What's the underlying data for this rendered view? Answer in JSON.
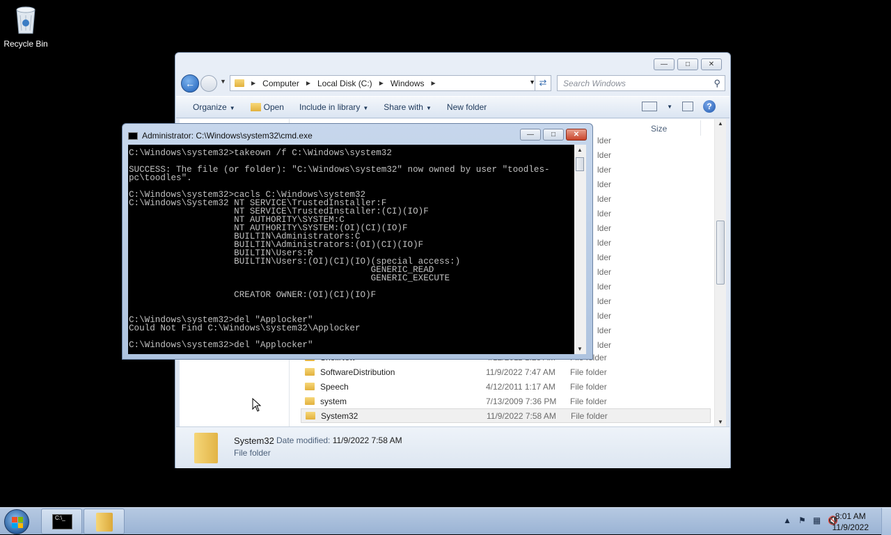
{
  "desktop": {
    "recycle_bin_label": "Recycle Bin"
  },
  "explorer": {
    "address": {
      "crumbs": [
        "Computer",
        "Local Disk (C:)",
        "Windows"
      ]
    },
    "search_placeholder": "Search Windows",
    "toolbar": {
      "organize": "Organize",
      "open": "Open",
      "include_in_library": "Include in library",
      "share_with": "Share with",
      "new_folder": "New folder"
    },
    "column_size": "Size",
    "partial_type": "lder",
    "rows": [
      {
        "name": "ShellNew",
        "date": "4/12/2011 1:28 AM",
        "type": "File folder"
      },
      {
        "name": "SoftwareDistribution",
        "date": "11/9/2022 7:47 AM",
        "type": "File folder"
      },
      {
        "name": "Speech",
        "date": "4/12/2011 1:17 AM",
        "type": "File folder"
      },
      {
        "name": "system",
        "date": "7/13/2009 7:36 PM",
        "type": "File folder"
      },
      {
        "name": "System32",
        "date": "11/9/2022 7:58 AM",
        "type": "File folder"
      }
    ],
    "details": {
      "name": "System32",
      "date_label": "Date modified:",
      "date_value": "11/9/2022 7:58 AM",
      "type": "File folder"
    }
  },
  "cmd": {
    "title": "Administrator: C:\\Windows\\system32\\cmd.exe",
    "output": "C:\\Windows\\system32>takeown /f C:\\Windows\\system32\n\nSUCCESS: The file (or folder): \"C:\\Windows\\system32\" now owned by user \"toodles-\npc\\toodles\".\n\nC:\\Windows\\system32>cacls C:\\Windows\\system32\nC:\\Windows\\System32 NT SERVICE\\TrustedInstaller:F\n                    NT SERVICE\\TrustedInstaller:(CI)(IO)F\n                    NT AUTHORITY\\SYSTEM:C\n                    NT AUTHORITY\\SYSTEM:(OI)(CI)(IO)F\n                    BUILTIN\\Administrators:C\n                    BUILTIN\\Administrators:(OI)(CI)(IO)F\n                    BUILTIN\\Users:R\n                    BUILTIN\\Users:(OI)(CI)(IO)(special access:)\n                                              GENERIC_READ\n                                              GENERIC_EXECUTE\n\n                    CREATOR OWNER:(OI)(CI)(IO)F\n\n\nC:\\Windows\\system32>del \"Applocker\"\nCould Not Find C:\\Windows\\system32\\Applocker\n\nC:\\Windows\\system32>del \"Applocker\""
  },
  "taskbar": {
    "cmd_icon_text": "C:\\_",
    "clock_time": "8:01 AM",
    "clock_date": "11/9/2022"
  }
}
